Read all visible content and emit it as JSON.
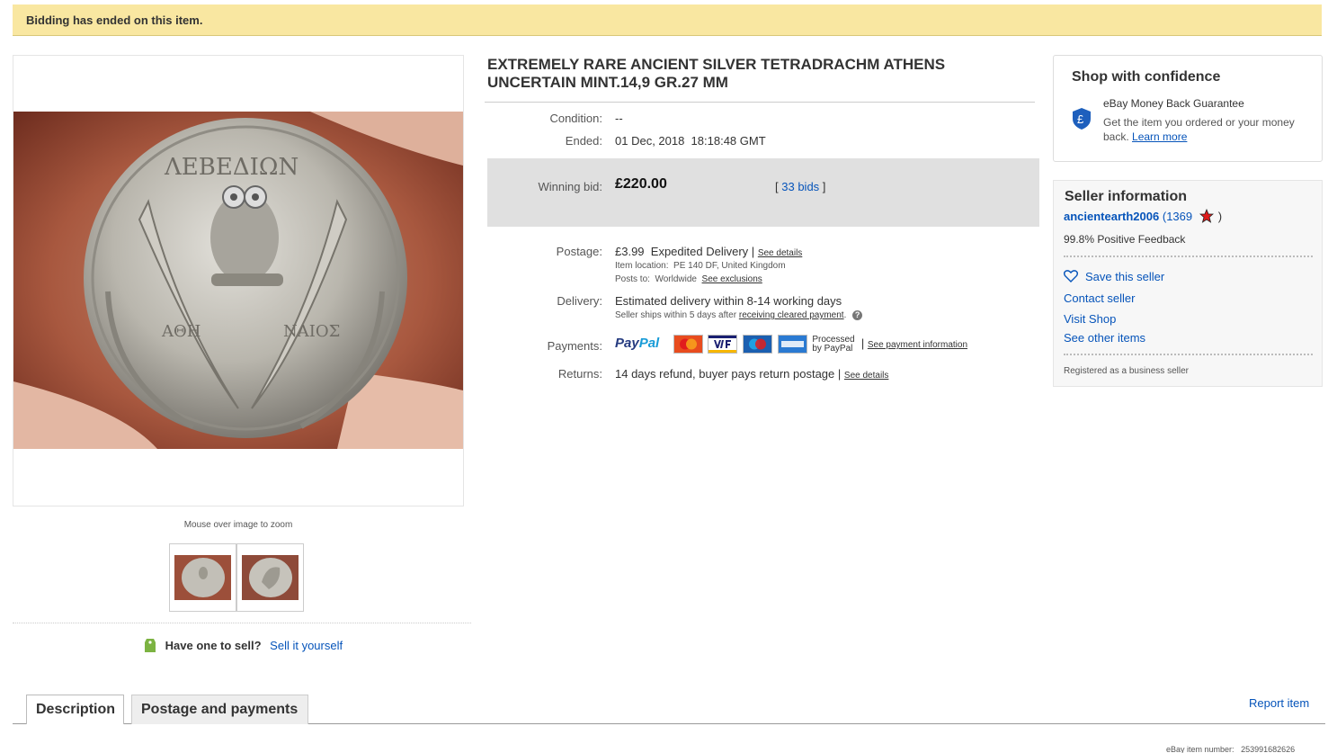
{
  "banner": {
    "text": "Bidding has ended on this item."
  },
  "gallery": {
    "zoom_hint": "Mouse over image to zoom",
    "sell": {
      "question": "Have one to sell?",
      "link": "Sell it yourself"
    }
  },
  "item": {
    "title": "EXTREMELY RARE ANCIENT SILVER TETRADRACHM ATHENS UNCERTAIN MINT.14,9 GR.27 MM",
    "condition_label": "Condition:",
    "condition_value": "--",
    "ended_label": "Ended:",
    "ended_value": "01 Dec, 2018  18:18:48 GMT",
    "winning_label": "Winning bid:",
    "winning_value": "£220.00",
    "bids_open": "[",
    "bids_link": "33 bids",
    "bids_close": "]",
    "postage_label": "Postage:",
    "postage_price": "£3.99",
    "postage_method": "Expedited Delivery",
    "postage_sep": "|",
    "postage_details": "See details",
    "location_label": "Item location:",
    "location_value": "PE 140 DF, United Kingdom",
    "posts_label": "Posts to:",
    "posts_value": "Worldwide",
    "posts_exclusions": "See exclusions",
    "delivery_label": "Delivery:",
    "delivery_value": "Estimated delivery within 8-14 working days",
    "delivery_note": "Seller ships within 5 days after",
    "delivery_note_link": "receiving cleared payment",
    "delivery_note_end": ".",
    "help_icon": "?",
    "payments_label": "Payments:",
    "paypal_a": "Pay",
    "paypal_b": "Pal",
    "processed_line1": "Processed",
    "processed_line2": "by PayPal",
    "payments_sep": "|",
    "payments_link": "See payment information",
    "returns_label": "Returns:",
    "returns_value": "14 days refund, buyer pays return postage",
    "returns_sep": "|",
    "returns_link": "See details"
  },
  "confidence": {
    "heading": "Shop with confidence",
    "guarantee_title": "eBay Money Back Guarantee",
    "guarantee_desc": "Get the item you ordered or your money back.",
    "learn_more": "Learn more"
  },
  "seller": {
    "heading": "Seller information",
    "name": "ancientearth2006",
    "open_paren": "(",
    "score": "1369",
    "close_paren": ")",
    "feedback": "99.8% Positive Feedback",
    "save": "Save this seller",
    "contact": "Contact seller",
    "shop": "Visit Shop",
    "other": "See other items",
    "registered": "Registered as a business seller"
  },
  "tabs": {
    "description": "Description",
    "postage": "Postage and payments"
  },
  "report": "Report item",
  "item_number_label": "eBay item number:",
  "item_number": "253991682626",
  "colors": {
    "banner": "#f9e7a1",
    "link": "#0654ba",
    "bid_box": "#e0e0e0"
  },
  "icons": [
    "coin-photo",
    "price-tag-icon",
    "shield-pound-icon",
    "red-star-icon",
    "heart-icon",
    "help-icon",
    "mastercard-icon",
    "visa-icon",
    "maestro-icon",
    "amex-icon"
  ]
}
